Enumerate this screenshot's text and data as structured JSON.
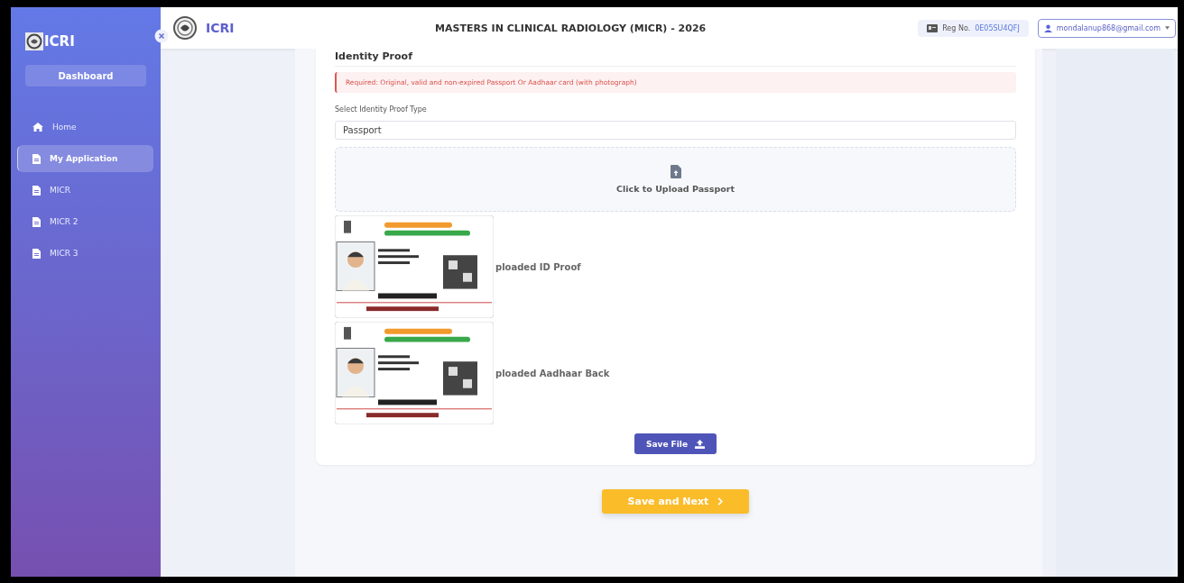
{
  "sidebar": {
    "logo_text": "ICRI",
    "dashboard_button": "Dashboard",
    "items": [
      {
        "label": "Home",
        "kind": "home",
        "selected": false
      },
      {
        "label": "My Application",
        "kind": "page",
        "selected": true
      },
      {
        "label": "MICR",
        "kind": "page",
        "selected": false
      },
      {
        "label": "MICR 2",
        "kind": "page",
        "selected": false
      },
      {
        "label": "MICR 3",
        "kind": "page",
        "selected": false
      }
    ]
  },
  "header": {
    "brand": "ICRI",
    "title": "MASTERS IN CLINICAL RADIOLOGY (MICR) - 2026",
    "reg_label": "Reg No.",
    "reg_number": "0E05SU4QFJ",
    "user_email": "mondalanup868@gmail.com"
  },
  "form": {
    "section_title": "Identity Proof",
    "alert": "Required: Original, valid and non-expired Passport Or Aadhaar card (with photograph)",
    "select_label": "Select Identity Proof Type",
    "select_value": "Passport",
    "upload_text": "Click to Upload Passport",
    "uploads": [
      {
        "label": "ploaded ID Proof",
        "kind": "picture"
      },
      {
        "label": "ploaded Aadhaar Back",
        "kind": "picture"
      }
    ],
    "save_file_button": "Save File"
  },
  "save_next_button": "Save and Next"
}
